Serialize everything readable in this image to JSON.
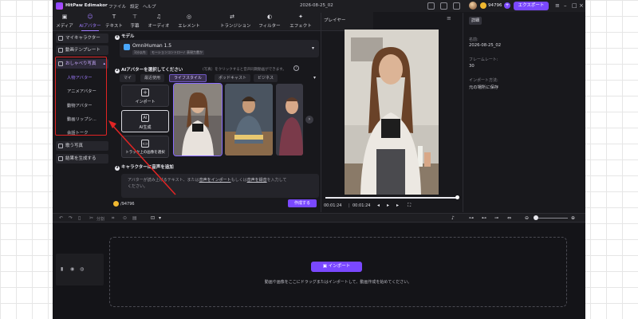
{
  "app": {
    "name": "HitPaw Edimakor",
    "menu": [
      "ファイル",
      "設定",
      "ヘルプ"
    ],
    "doc_title": "2026-08-25_02",
    "credits": "94796",
    "export_label": "エクスポート",
    "accent_color": "#7a48ff"
  },
  "categories": [
    {
      "label": "メディア",
      "icon": "media-icon"
    },
    {
      "label": "AIアバター",
      "icon": "ai-avatar-icon",
      "active": true
    },
    {
      "label": "テキスト",
      "icon": "text-icon"
    },
    {
      "label": "字幕",
      "icon": "subtitle-icon"
    },
    {
      "label": "オーディオ",
      "icon": "audio-icon"
    },
    {
      "label": "エレメント",
      "icon": "element-icon"
    },
    {
      "label": "トランジション",
      "icon": "transition-icon"
    },
    {
      "label": "フィルター",
      "icon": "filter-icon"
    },
    {
      "label": "エフェクト",
      "icon": "effect-icon"
    }
  ],
  "leftnav": {
    "my_character": "マイキャラクター",
    "video_template": "動画テンプレート",
    "talking_photo": "おしゃべり写真",
    "sub_items": [
      "人物アバター",
      "アニメアバター",
      "動物アバター",
      "動画リップシ...",
      "会話トーク"
    ],
    "singing_photo": "歌う写真",
    "generate_result": "結果を生成する"
  },
  "config": {
    "step1_label": "モデル",
    "model_name": "OmniHuman 1.5",
    "model_tags": [
      "1分以内",
      "モーションコントロール",
      "表現力豊か"
    ],
    "step2_label": "AIアバターを選択してください",
    "step2_hint": "(写真）をクリックすると音声同期動画ができます。",
    "tabs": [
      "マイ",
      "最近使用",
      "ライフスタイル",
      "ポッドキャスト",
      "ビジネス"
    ],
    "active_tab": 2,
    "import_label": "インポート",
    "ai_generate_label": "AI生成",
    "track_select_label": "トラック上の画像を選択",
    "step3_label": "キャラクターに音声を追加",
    "text_hint_1": "アバターが読み上げるテキスト、または",
    "text_link_import": "音声をインポート",
    "text_hint_2": "もしくは",
    "text_link_record": "音声を録音",
    "text_hint_3": "を入力して",
    "text_hint_4": "ください。",
    "bottom_credits": "/94796",
    "create_label": "作成する"
  },
  "player": {
    "title": "プレイヤー",
    "current_time": "00:01:24",
    "total_time": "00:01:24",
    "progress": 1.0
  },
  "details": {
    "tab_label": "詳細",
    "name_label": "名前:",
    "name_value": "2026-08-25_02",
    "framerate_label": "フレームレート:",
    "framerate_value": "30",
    "import_method_label": "インポート方法:",
    "import_method_value": "元の場所に保存"
  },
  "timeline": {
    "split_label": "分割",
    "import_label": "インポート",
    "drop_hint": "動画や画像をここにドラッグまたはインポートして、動画作成を始めてください。"
  }
}
